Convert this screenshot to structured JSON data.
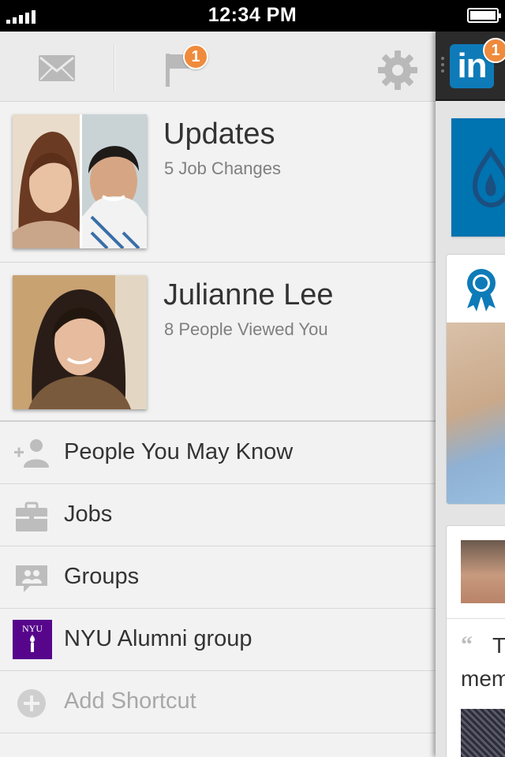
{
  "status_bar": {
    "time": "12:34 PM"
  },
  "toolbar": {
    "icons": [
      "mail-icon",
      "flag-icon",
      "gear-icon"
    ],
    "notifications_badge": "1"
  },
  "updates": [
    {
      "title": "Updates",
      "subtitle": "5 Job Changes"
    },
    {
      "title": "Julianne Lee",
      "subtitle": "8 People Viewed You"
    }
  ],
  "nav": [
    {
      "label": "People You May Know",
      "icon": "add-person-icon"
    },
    {
      "label": "Jobs",
      "icon": "briefcase-icon"
    },
    {
      "label": "Groups",
      "icon": "groups-icon"
    },
    {
      "label": "NYU Alumni group",
      "icon": "nyu-logo"
    },
    {
      "label": "Add Shortcut",
      "icon": "plus-circle-icon"
    }
  ],
  "nyu_logo_text": "NYU",
  "peek": {
    "logo_text": "in",
    "badge": "1",
    "quote_start": "T",
    "quote_line2": "mem"
  },
  "colors": {
    "badge": "#f08a3c",
    "linkedin_blue": "#0e7bb8",
    "nyu_purple": "#57068c"
  }
}
